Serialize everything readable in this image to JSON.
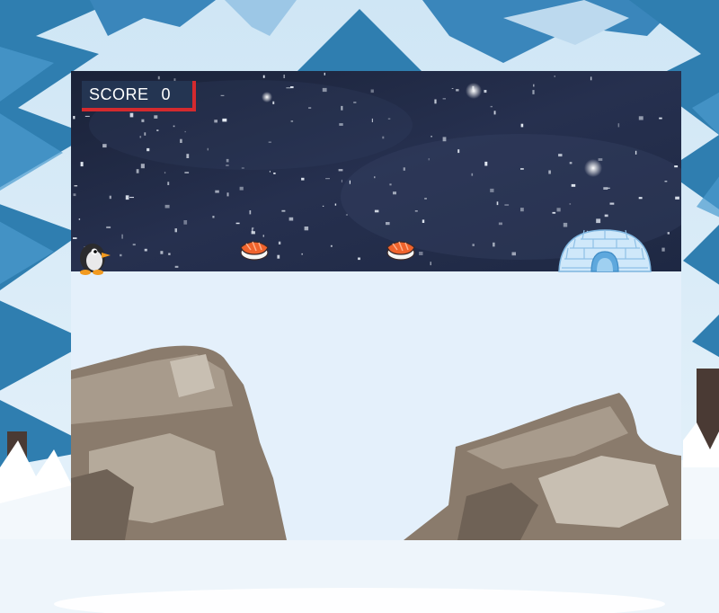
{
  "hud": {
    "score_label": "SCORE",
    "score_value": "0"
  },
  "sprites": {
    "player": "penguin",
    "pickups": [
      "sushi",
      "sushi"
    ],
    "goal": "igloo"
  },
  "colors": {
    "hud_background": "#243552",
    "hud_accent": "#d42a2e",
    "night_sky": "#1c2540",
    "ground": "#e4f0fb",
    "rock": "#8a7b6c",
    "pine": "#2f7eb0"
  }
}
